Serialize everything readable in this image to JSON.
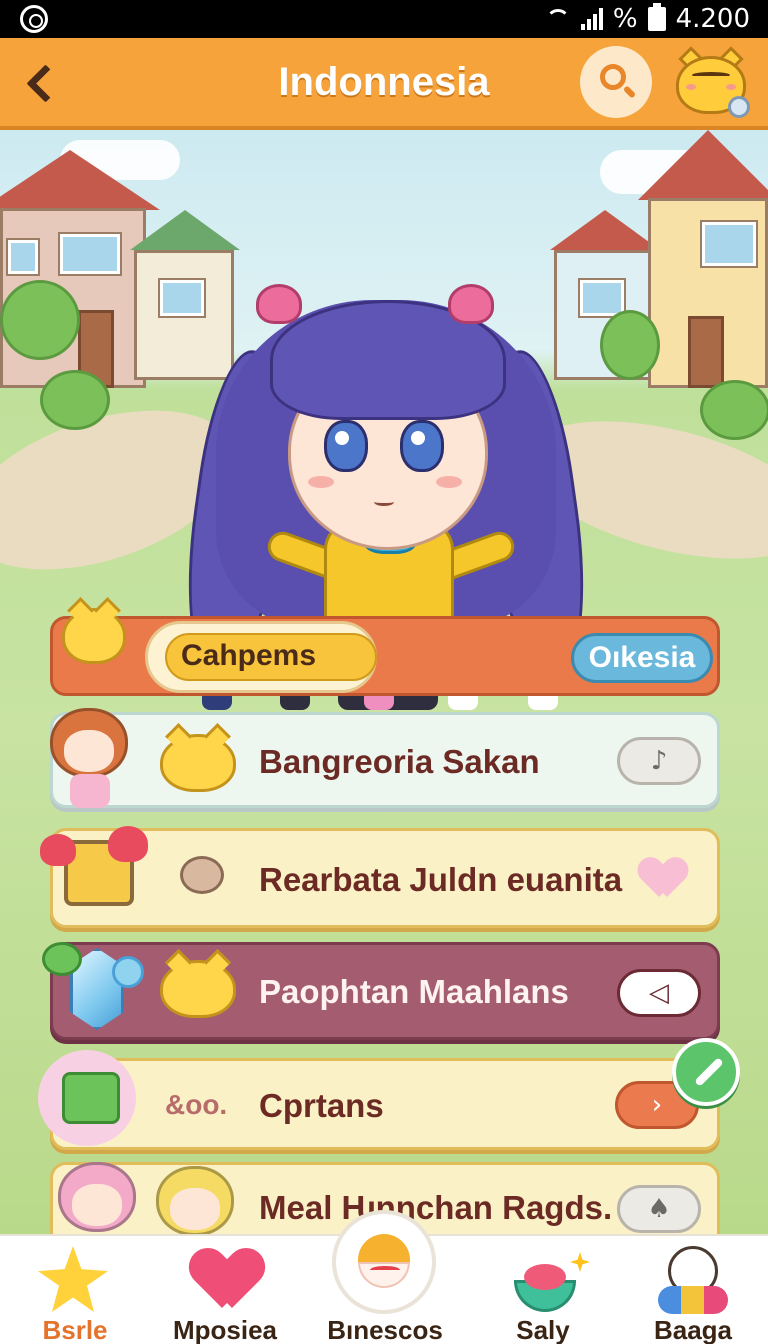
{
  "status_bar": {
    "battery_text": "%",
    "time": "4.200"
  },
  "header": {
    "title": "Indonnesia"
  },
  "featured": {
    "category_label": "Cahpems",
    "action_label": "Oıkesia"
  },
  "list": [
    {
      "label": "Bangreoria Sakan",
      "control": "grey"
    },
    {
      "label": "Rearbata Juldn euanita",
      "control": "heart"
    },
    {
      "label": "Paophtan Maahlans",
      "control": "white"
    },
    {
      "label": "Cprtans",
      "prefix": "&oo.",
      "control": "orange"
    },
    {
      "label": "Meal Ƕnnchan Ragds.",
      "control": "grey"
    }
  ],
  "nav": [
    {
      "label": "Bsrle",
      "icon": "star-icon",
      "active": true
    },
    {
      "label": "Mposiea",
      "icon": "heart-icon"
    },
    {
      "label": "Bınescos",
      "icon": "egg-icon"
    },
    {
      "label": "Saly",
      "icon": "bowl-icon"
    },
    {
      "label": "Baaga",
      "icon": "ghost-icon"
    }
  ],
  "colors": {
    "header": "#f5a33a",
    "featured": "#ea7a4a",
    "accent_blue": "#6ab8dc",
    "row_maroon": "#a35c70",
    "row_cream": "#fbf1c6",
    "fab": "#5cc46a"
  }
}
